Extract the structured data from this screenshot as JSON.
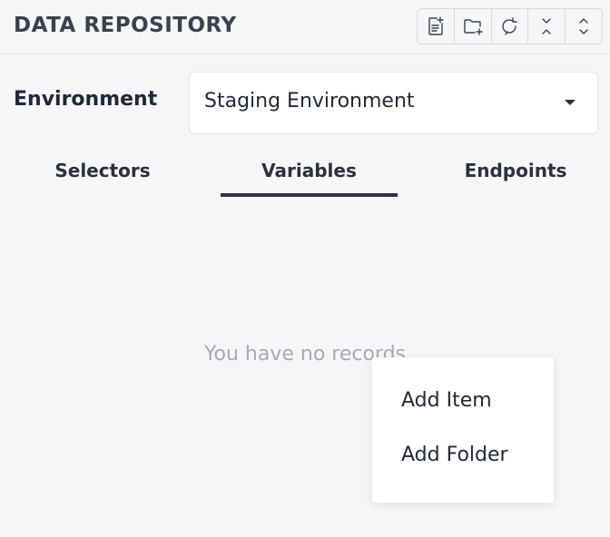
{
  "header": {
    "title": "DATA REPOSITORY",
    "toolbar": [
      {
        "icon": "new-file-icon"
      },
      {
        "icon": "new-folder-icon"
      },
      {
        "icon": "refresh-icon"
      },
      {
        "icon": "collapse-all-icon"
      },
      {
        "icon": "expand-all-icon"
      }
    ]
  },
  "environment": {
    "label": "Environment",
    "selected": "Staging Environment"
  },
  "tabs": [
    {
      "label": "Selectors",
      "active": false
    },
    {
      "label": "Variables",
      "active": true
    },
    {
      "label": "Endpoints",
      "active": false
    }
  ],
  "empty_state": "You have no records",
  "context_menu": {
    "items": [
      {
        "label": "Add Item"
      },
      {
        "label": "Add Folder"
      }
    ]
  },
  "colors": {
    "background": "#f5f6f8",
    "text": "#1f2937",
    "muted": "#a5abb3",
    "active_tab_underline": "#2e3644"
  }
}
